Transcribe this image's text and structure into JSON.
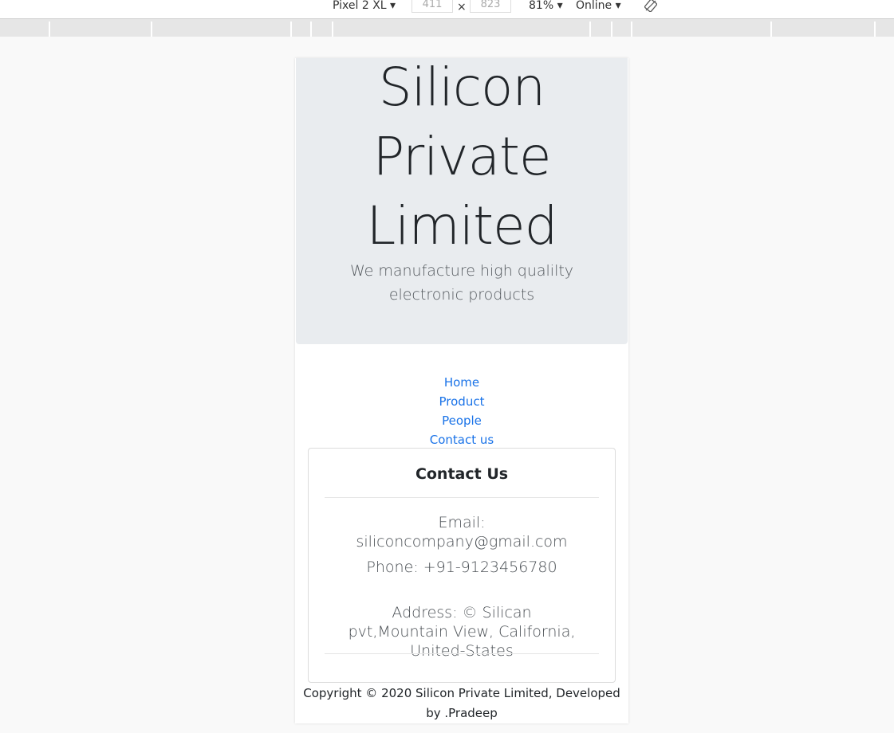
{
  "devtools": {
    "device": "Pixel 2 XL ▾",
    "width": "411",
    "height": "823",
    "times": "×",
    "zoom": "81% ▾",
    "network": "Online ▾"
  },
  "hero": {
    "title_line1": "Silicon",
    "title_line2": "Private",
    "title_line3": "Limited",
    "subtitle": "We manufacture high qualilty electronic products"
  },
  "nav": {
    "items": [
      "Home",
      "Product",
      "People",
      "Contact us"
    ]
  },
  "contact": {
    "title": "Contact Us",
    "email": "Email: siliconcompany@gmail.com",
    "phone": "Phone: +91-9123456780",
    "address": "Address: © Silican pvt,Mountain View, California, United-States"
  },
  "footer": {
    "text": "Copyright © 2020 Silicon Private Limited, Developed by .Pradeep"
  },
  "colors": {
    "link": "#1a73e8",
    "jumbotron_bg": "#e9ecef",
    "page_bg": "#f9f9f9"
  },
  "icons": {
    "rotate": "rotate-icon"
  }
}
